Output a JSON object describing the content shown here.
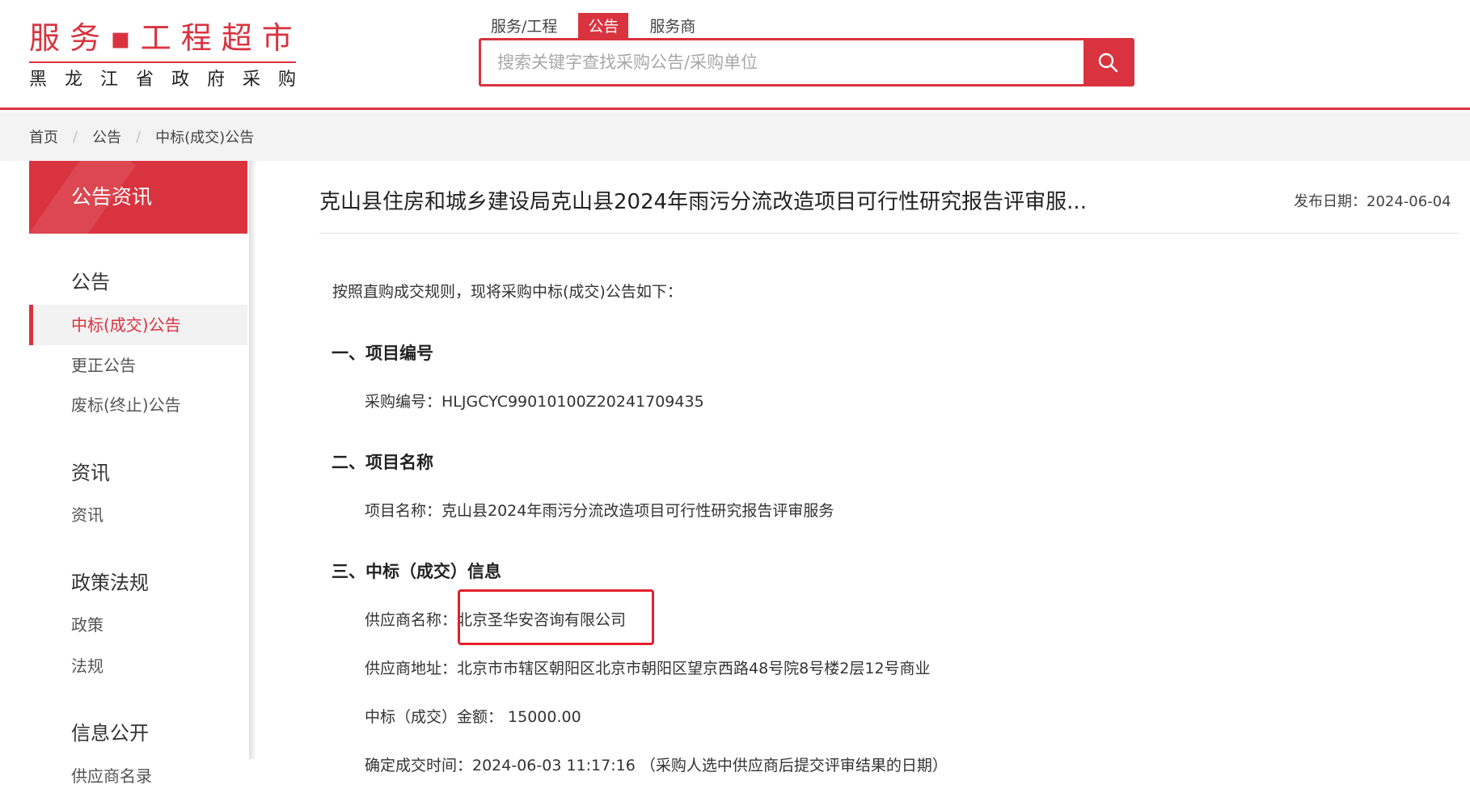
{
  "logo": {
    "top": "服务▪工程超市",
    "bottom": "黑龙江省政府采购"
  },
  "search": {
    "tabs": [
      "服务/工程",
      "公告",
      "服务商"
    ],
    "active_tab": "公告",
    "placeholder": "搜索关键字查找采购公告/采购单位",
    "icon": "search-icon"
  },
  "breadcrumb": [
    "首页",
    "公告",
    "中标(成交)公告"
  ],
  "sidebar": {
    "header": "公告资讯",
    "groups": [
      {
        "title": "公告",
        "items": [
          "中标(成交)公告",
          "更正公告",
          "废标(终止)公告"
        ]
      },
      {
        "title": "资讯",
        "items": [
          "资讯"
        ]
      },
      {
        "title": "政策法规",
        "items": [
          "政策",
          "法规"
        ]
      },
      {
        "title": "信息公开",
        "items": [
          "供应商名录"
        ]
      }
    ],
    "active_item": "中标(成交)公告"
  },
  "article": {
    "title": "克山县住房和城乡建设局克山县2024年雨污分流改造项目可行性研究报告评审服...",
    "date_label": "发布日期：",
    "date": "2024-06-04",
    "intro": "按照直购成交规则，现将采购中标(成交)公告如下：",
    "sections": [
      {
        "heading": "一、项目编号",
        "lines": [
          "采购编号：HLJGCYC99010100Z20241709435"
        ]
      },
      {
        "heading": "二、项目名称",
        "lines": [
          "项目名称：克山县2024年雨污分流改造项目可行性研究报告评审服务"
        ]
      },
      {
        "heading": "三、中标（成交）信息",
        "supplier_label": "供应商名称：",
        "supplier_name": "北京圣华安咨询有限公司",
        "lines": [
          "供应商地址：北京市市辖区朝阳区北京市朝阳区望京西路48号院8号楼2层12号商业",
          "中标（成交）金额：  15000.00",
          "确定成交时间：2024-06-03 11:17:16 （采购人选中供应商后提交评审结果的日期）"
        ]
      }
    ]
  },
  "colors": {
    "brand_red": "#d9333f",
    "highlight_red": "#e5202e"
  }
}
